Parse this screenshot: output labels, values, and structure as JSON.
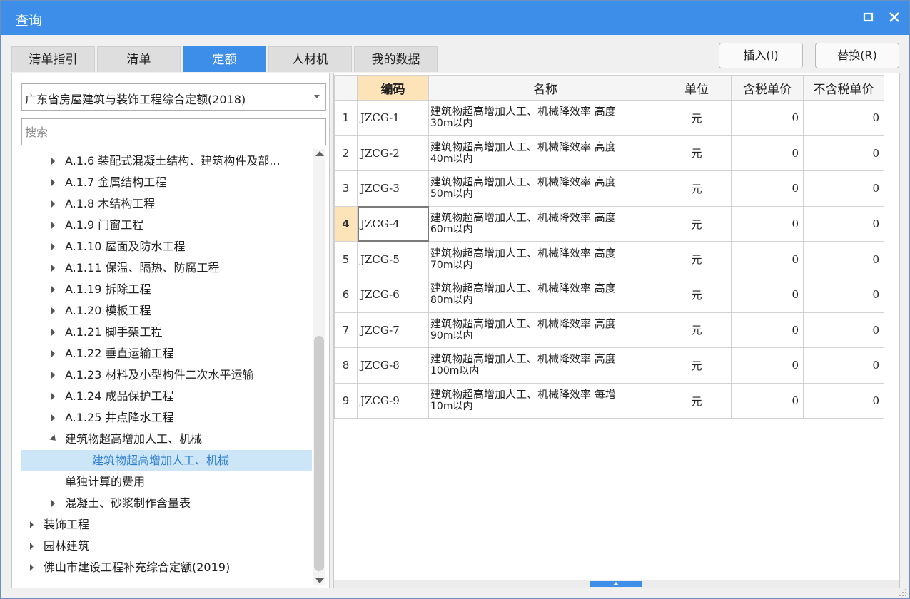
{
  "window": {
    "title": "查询",
    "maximize_icon": "maximize-icon",
    "close_icon": "close-icon",
    "accent_color": "#3c8ee9"
  },
  "tabs": [
    {
      "label": "清单指引",
      "active": false
    },
    {
      "label": "清单",
      "active": false
    },
    {
      "label": "定额",
      "active": true
    },
    {
      "label": "人材机",
      "active": false
    },
    {
      "label": "我的数据",
      "active": false
    }
  ],
  "actions": {
    "insert_label": "插入(I)",
    "replace_label": "替换(R)"
  },
  "left": {
    "library_selected": "广东省房屋建筑与装饰工程综合定额(2018)",
    "search_placeholder": "搜索",
    "tree": [
      {
        "label": "A.1.6 装配式混凝土结构、建筑构件及部...",
        "state": "collapsed",
        "level": 1
      },
      {
        "label": "A.1.7 金属结构工程",
        "state": "collapsed",
        "level": 1
      },
      {
        "label": "A.1.8 木结构工程",
        "state": "collapsed",
        "level": 1
      },
      {
        "label": "A.1.9 门窗工程",
        "state": "collapsed",
        "level": 1
      },
      {
        "label": "A.1.10 屋面及防水工程",
        "state": "collapsed",
        "level": 1
      },
      {
        "label": "A.1.11 保温、隔热、防腐工程",
        "state": "collapsed",
        "level": 1
      },
      {
        "label": "A.1.19 拆除工程",
        "state": "collapsed",
        "level": 1
      },
      {
        "label": "A.1.20 模板工程",
        "state": "collapsed",
        "level": 1
      },
      {
        "label": "A.1.21 脚手架工程",
        "state": "collapsed",
        "level": 1
      },
      {
        "label": "A.1.22 垂直运输工程",
        "state": "collapsed",
        "level": 1
      },
      {
        "label": "A.1.23 材料及小型构件二次水平运输",
        "state": "collapsed",
        "level": 1
      },
      {
        "label": "A.1.24 成品保护工程",
        "state": "collapsed",
        "level": 1
      },
      {
        "label": "A.1.25 井点降水工程",
        "state": "collapsed",
        "level": 1
      },
      {
        "label": "建筑物超高增加人工、机械",
        "state": "expanded",
        "level": 1
      },
      {
        "label": "建筑物超高增加人工、机械",
        "state": "leaf",
        "level": 2,
        "selected": true
      },
      {
        "label": "单独计算的费用",
        "state": "leaf",
        "level": 1
      },
      {
        "label": "混凝土、砂浆制作含量表",
        "state": "collapsed",
        "level": 1
      },
      {
        "label": "装饰工程",
        "state": "collapsed",
        "level": 0
      },
      {
        "label": "园林建筑",
        "state": "collapsed",
        "level": 0
      },
      {
        "label": "佛山市建设工程补充综合定额(2019)",
        "state": "collapsed",
        "level": 0
      }
    ]
  },
  "grid": {
    "columns": [
      "",
      "编码",
      "名称",
      "单位",
      "含税单价",
      "不含税单价"
    ],
    "current_row": 4,
    "rows": [
      {
        "no": "1",
        "code": "JZCG-1",
        "name_line1": "建筑物超高增加人工、机械降效率 高度",
        "name_line2": "30m以内",
        "unit": "元",
        "price_tax": "0",
        "price_notax": "0"
      },
      {
        "no": "2",
        "code": "JZCG-2",
        "name_line1": "建筑物超高增加人工、机械降效率 高度",
        "name_line2": "40m以内",
        "unit": "元",
        "price_tax": "0",
        "price_notax": "0"
      },
      {
        "no": "3",
        "code": "JZCG-3",
        "name_line1": "建筑物超高增加人工、机械降效率 高度",
        "name_line2": "50m以内",
        "unit": "元",
        "price_tax": "0",
        "price_notax": "0"
      },
      {
        "no": "4",
        "code": "JZCG-4",
        "name_line1": "建筑物超高增加人工、机械降效率 高度",
        "name_line2": "60m以内",
        "unit": "元",
        "price_tax": "0",
        "price_notax": "0"
      },
      {
        "no": "5",
        "code": "JZCG-5",
        "name_line1": "建筑物超高增加人工、机械降效率 高度",
        "name_line2": "70m以内",
        "unit": "元",
        "price_tax": "0",
        "price_notax": "0"
      },
      {
        "no": "6",
        "code": "JZCG-6",
        "name_line1": "建筑物超高增加人工、机械降效率 高度",
        "name_line2": "80m以内",
        "unit": "元",
        "price_tax": "0",
        "price_notax": "0"
      },
      {
        "no": "7",
        "code": "JZCG-7",
        "name_line1": "建筑物超高增加人工、机械降效率 高度",
        "name_line2": "90m以内",
        "unit": "元",
        "price_tax": "0",
        "price_notax": "0"
      },
      {
        "no": "8",
        "code": "JZCG-8",
        "name_line1": "建筑物超高增加人工、机械降效率 高度",
        "name_line2": "100m以内",
        "unit": "元",
        "price_tax": "0",
        "price_notax": "0"
      },
      {
        "no": "9",
        "code": "JZCG-9",
        "name_line1": "建筑物超高增加人工、机械降效率 每增",
        "name_line2": "10m以内",
        "unit": "元",
        "price_tax": "0",
        "price_notax": "0"
      }
    ]
  }
}
